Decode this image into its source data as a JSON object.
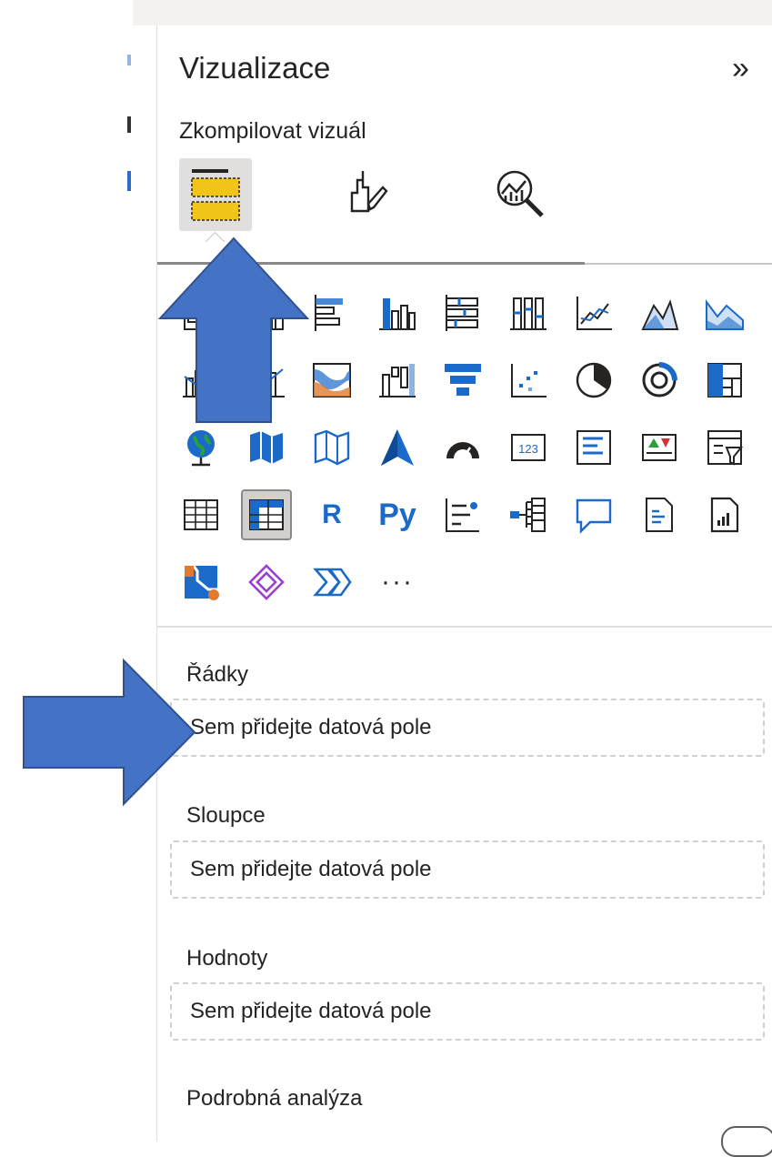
{
  "pane": {
    "title": "Vizualizace",
    "subtitle": "Zkompilovat vizuál",
    "tabs": [
      {
        "name": "build-visual",
        "icon": "table-build-icon",
        "active": true
      },
      {
        "name": "format-visual",
        "icon": "paintbrush-icon",
        "active": false
      },
      {
        "name": "analytics",
        "icon": "magnifier-analytics-icon",
        "active": false
      }
    ],
    "visual_text_icons": {
      "r": "R",
      "py": "Py",
      "more": "···"
    }
  },
  "wells": {
    "rows": {
      "label": "Řádky",
      "placeholder": "Sem přidejte datová pole"
    },
    "columns": {
      "label": "Sloupce",
      "placeholder": "Sem přidejte datová pole"
    },
    "values": {
      "label": "Hodnoty",
      "placeholder": "Sem přidejte datová pole"
    },
    "drillthrough": {
      "label": "Podrobná analýza"
    }
  },
  "colors": {
    "accent": "#4472c4",
    "icon_blue": "#1b6ac9",
    "matrix_yellow": "#f0c419"
  }
}
